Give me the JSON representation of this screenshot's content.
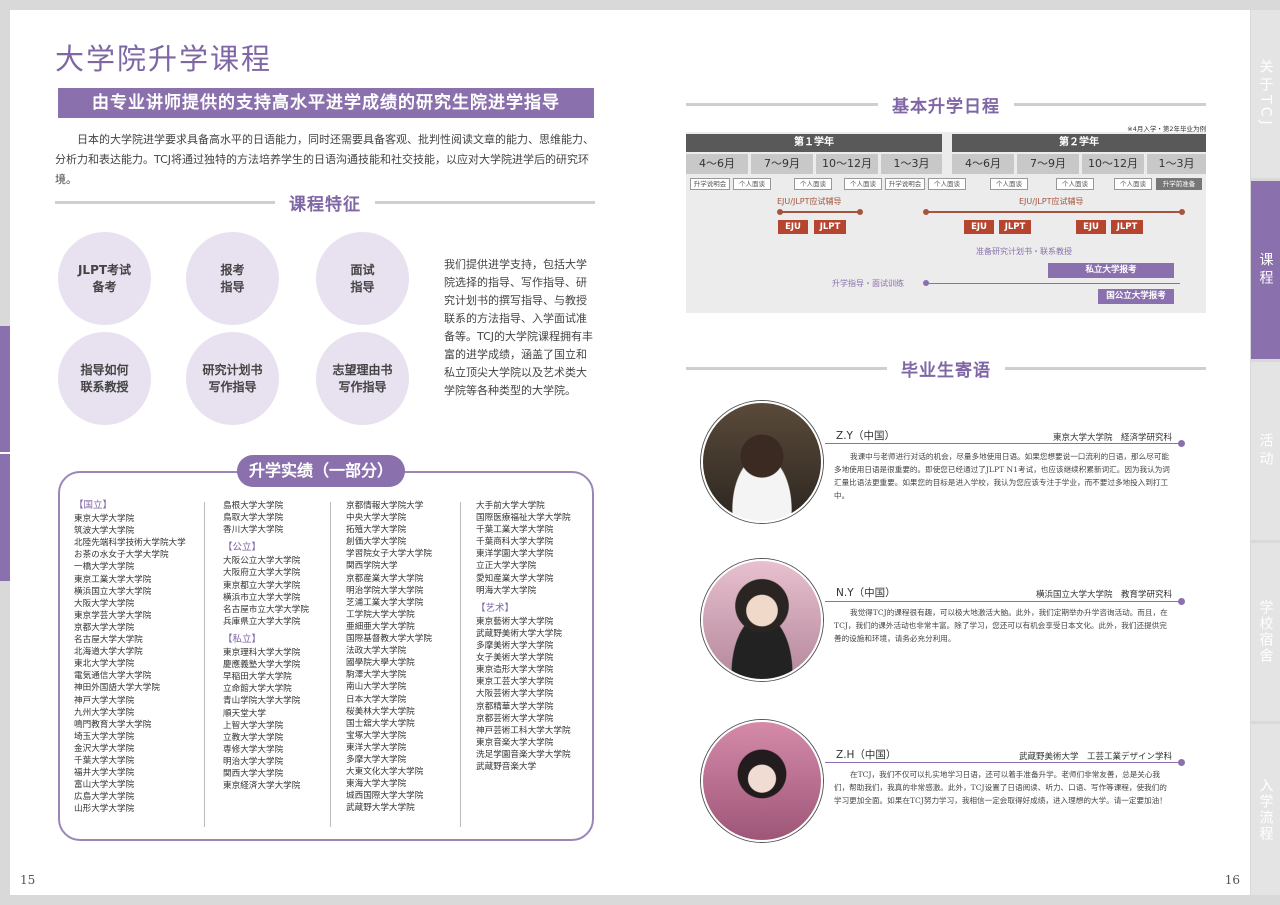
{
  "left": {
    "title": "大学院升学课程",
    "banner": "由专业讲师提供的支持高水平进学成绩的研究生院进学指导",
    "intro": "日本的大学院进学要求具备高水平的日语能力，同时还需要具备客观、批判性阅读文章的能力、思维能力、分析力和表达能力。TCJ将通过独特的方法培养学生的日语沟通技能和社交技能，以应对大学院进学后的研究环境。",
    "features_heading": "课程特征",
    "features": [
      "JLPT考试\n备考",
      "报考\n指导",
      "面试\n指导",
      "指导如何\n联系教授",
      "研究计划书\n写作指导",
      "志望理由书\n写作指导"
    ],
    "features_text": "我们提供进学支持，包括大学院选择的指导、写作指导、研究计划书的撰写指导、与教授联系的方法指导、入学面试准备等。TCJ的大学院课程拥有丰富的进学成绩，涵盖了国立和私立顶尖大学院以及艺术类大学院等各种类型的大学院。",
    "results_heading": "升学实绩（一部分）",
    "col1": {
      "cat": "【国立】",
      "items": [
        "東京大学大学院",
        "筑波大学大学院",
        "北陸先端科学技術大学院大学",
        "お茶の水女子大学大学院",
        "一橋大学大学院",
        "東京工業大学大学院",
        "横浜国立大学大学院",
        "大阪大学大学院",
        "東京学芸大学大学院",
        "京都大学大学院",
        "名古屋大学大学院",
        "北海道大学大学院",
        "東北大学大学院",
        "電気通信大学大学院",
        "神田外国語大学大学院",
        "神戸大学大学院",
        "九州大学大学院",
        "鳴門教育大学大学院",
        "埼玉大学大学院",
        "金沢大学大学院",
        "千葉大学大学院",
        "福井大学大学院",
        "富山大学大学院",
        "広島大学大学院",
        "山形大学大学院"
      ]
    },
    "col2a": [
      "島根大学大学院",
      "鳥取大学大学院",
      "香川大学大学院"
    ],
    "col2_cat_public": "【公立】",
    "col2b": [
      "大阪公立大学大学院",
      "大阪府立大学大学院",
      "東京都立大学大学院",
      "横浜市立大学大学院",
      "名古屋市立大学大学院",
      "兵庫県立大学大学院"
    ],
    "col2_cat_private": "【私立】",
    "col2c": [
      "東京理科大学大学院",
      "慶應義塾大学大学院",
      "早稲田大学大学院",
      "立命館大学大学院",
      "青山学院大学大学院",
      "順天堂大学",
      "上智大学大学院",
      "立教大学大学院",
      "専修大学大学院",
      "明治大学大学院",
      "関西大学大学院",
      "東京経済大学大学院"
    ],
    "col3": [
      "京都情報大学院大学",
      "中央大学大学院",
      "拓殖大学大学院",
      "創価大学大学院",
      "学習院女子大学大学院",
      "関西学院大学",
      "京都産業大学大学院",
      "明治学院大学大学院",
      "芝浦工業大学大学院",
      "工学院大学大学院",
      "亜細亜大学大学院",
      "国際基督教大学大学院",
      "法政大学大学院",
      "國學院大學大学院",
      "駒澤大学大学院",
      "南山大学大学院",
      "日本大学大学院",
      "桜美林大学大学院",
      "国士舘大学大学院",
      "宝塚大学大学院",
      "東洋大学大学院",
      "多摩大学大学院",
      "大東文化大学大学院",
      "東海大学大学院",
      "城西国際大学大学院",
      "武蔵野大学大学院"
    ],
    "col4a": [
      "大手前大学大学院",
      "国際医療福祉大学大学院",
      "千葉工業大学大学院",
      "千葉商科大学大学院",
      "東洋学園大学大学院",
      "立正大学大学院",
      "愛知産業大学大学院",
      "明海大学大学院"
    ],
    "col4_cat_art": "【艺术】",
    "col4b": [
      "東京藝術大学大学院",
      "武蔵野美術大学大学院",
      "多摩美術大学大学院",
      "女子美術大学大学院",
      "東京造形大学大学院",
      "東京工芸大学大学院",
      "大阪芸術大学大学院",
      "京都精華大学大学院",
      "京都芸術大学大学院",
      "神戸芸術工科大学大学院",
      "東京音楽大学大学院",
      "洗足学園音楽大学大学院",
      "武蔵野音楽大学"
    ],
    "page_number": "15"
  },
  "right": {
    "schedule_heading": "基本升学日程",
    "schedule_note": "※4月入学・第2年毕业为例",
    "year1": "第１学年",
    "year2": "第２学年",
    "quarters": [
      "4～6月",
      "7～9月",
      "10～12月",
      "1～3月",
      "4～6月",
      "7～9月",
      "10～12月",
      "1～3月"
    ],
    "tags": [
      "升学说明会",
      "个人面谈",
      "个人面谈",
      "个人面谈",
      "升学说明会",
      "个人面谈",
      "个人面谈",
      "个人面谈",
      "个人面谈",
      "升学前准备"
    ],
    "eju1_label": "EJU/JLPT应试辅导",
    "eju2_label": "EJU/JLPT应试辅导",
    "eju": "EJU",
    "jlpt": "JLPT",
    "research_label": "准备研究计划书・联系教授",
    "guidance_label": "升学指导・面试训练",
    "private_bar": "私立大学报考",
    "public_bar": "国公立大学报考",
    "testimonials_heading": "毕业生寄语",
    "testimonials": [
      {
        "name": "Z.Y（中国）",
        "school": "東京大学大学院　経済学研究科",
        "text": "我课中与老师进行对话的机会，尽量多地使用日语。如果您想要说一口流利的日语，那么尽可能多地使用日语是很重要的。即使您已经通过了JLPT N1考试，也应该继续积累新词汇。因为我认为词汇量比语法更重要。如果您的目标是进入学校，我认为您应该专注于学业，而不要过多地投入到打工中。"
      },
      {
        "name": "N.Y（中国）",
        "school": "横浜国立大学大学院　教育学研究科",
        "text": "我觉得TCJ的课程很有趣，可以极大地激活大脑。此外，我们定期举办升学咨询活动。而且，在TCJ，我们的课外活动也非常丰富。除了学习，您还可以有机会享受日本文化。此外，我们还提供完善的设施和环境，请务必充分利用。"
      },
      {
        "name": "Z.H（中国）",
        "school": "武蔵野美術大学　工芸工業デザイン学科",
        "text": "在TCJ，我们不仅可以扎实地学习日语，还可以着手准备升学。老师们非常友善，总是关心我们，帮助我们，我真的非常感激。此外，TCJ设置了日语阅读、听力、口语、写作等课程，使我们的学习更加全面。如果在TCJ努力学习，我相信一定会取得好成绩，进入理想的大学。请一定要加油！"
      }
    ],
    "page_number": "16"
  },
  "side_tabs": [
    {
      "label": "关于TCJ",
      "active": false
    },
    {
      "label": "课程",
      "active": true
    },
    {
      "label": "活动",
      "active": false
    },
    {
      "label": "学校宿舍",
      "active": false
    },
    {
      "label": "入学流程",
      "active": false
    }
  ],
  "colors": {
    "accent": "#8a70ad",
    "accent_light": "#e8e1ef",
    "brick": "#b5452f"
  }
}
